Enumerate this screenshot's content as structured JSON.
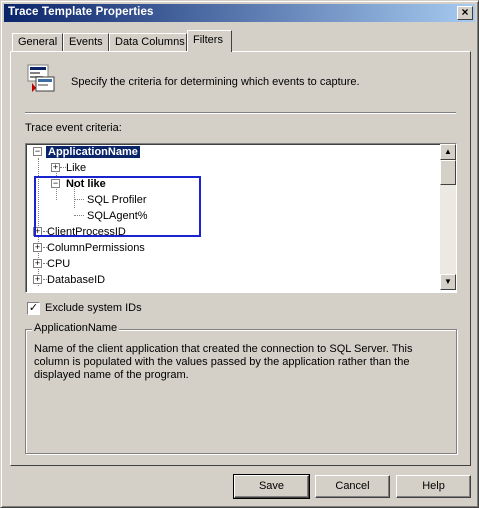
{
  "window": {
    "title": "Trace Template Properties"
  },
  "tabs": [
    {
      "label": "General"
    },
    {
      "label": "Events"
    },
    {
      "label": "Data Columns"
    },
    {
      "label": "Filters"
    }
  ],
  "active_tab": "Filters",
  "header": {
    "description": "Specify the criteria for determining which events to capture."
  },
  "criteria": {
    "label": "Trace event criteria:",
    "tree": {
      "root_selected": "ApplicationName",
      "like": "Like",
      "not_like": "Not like",
      "not_like_values": [
        "SQL Profiler",
        "SQLAgent%"
      ],
      "other_columns": [
        "ClientProcessID",
        "ColumnPermissions",
        "CPU",
        "DatabaseID"
      ]
    }
  },
  "exclude_system_ids": {
    "label": "Exclude system IDs",
    "checked": true
  },
  "details": {
    "title": "ApplicationName",
    "text": "Name of the client application that created the connection to SQL Server. This column is populated with the values passed by the application rather than the displayed name of the program."
  },
  "buttons": {
    "save": "Save",
    "cancel": "Cancel",
    "help": "Help"
  },
  "colors": {
    "title_gradient_start": "#0a246a",
    "title_gradient_end": "#a6caf0",
    "highlight_box": "#1a23d0",
    "dialog_face": "#d4d0c8"
  },
  "icons": [
    "close-icon",
    "filter-properties-icon",
    "scroll-up-icon",
    "scroll-down-icon",
    "expand-icon",
    "collapse-icon",
    "checkmark-icon"
  ]
}
